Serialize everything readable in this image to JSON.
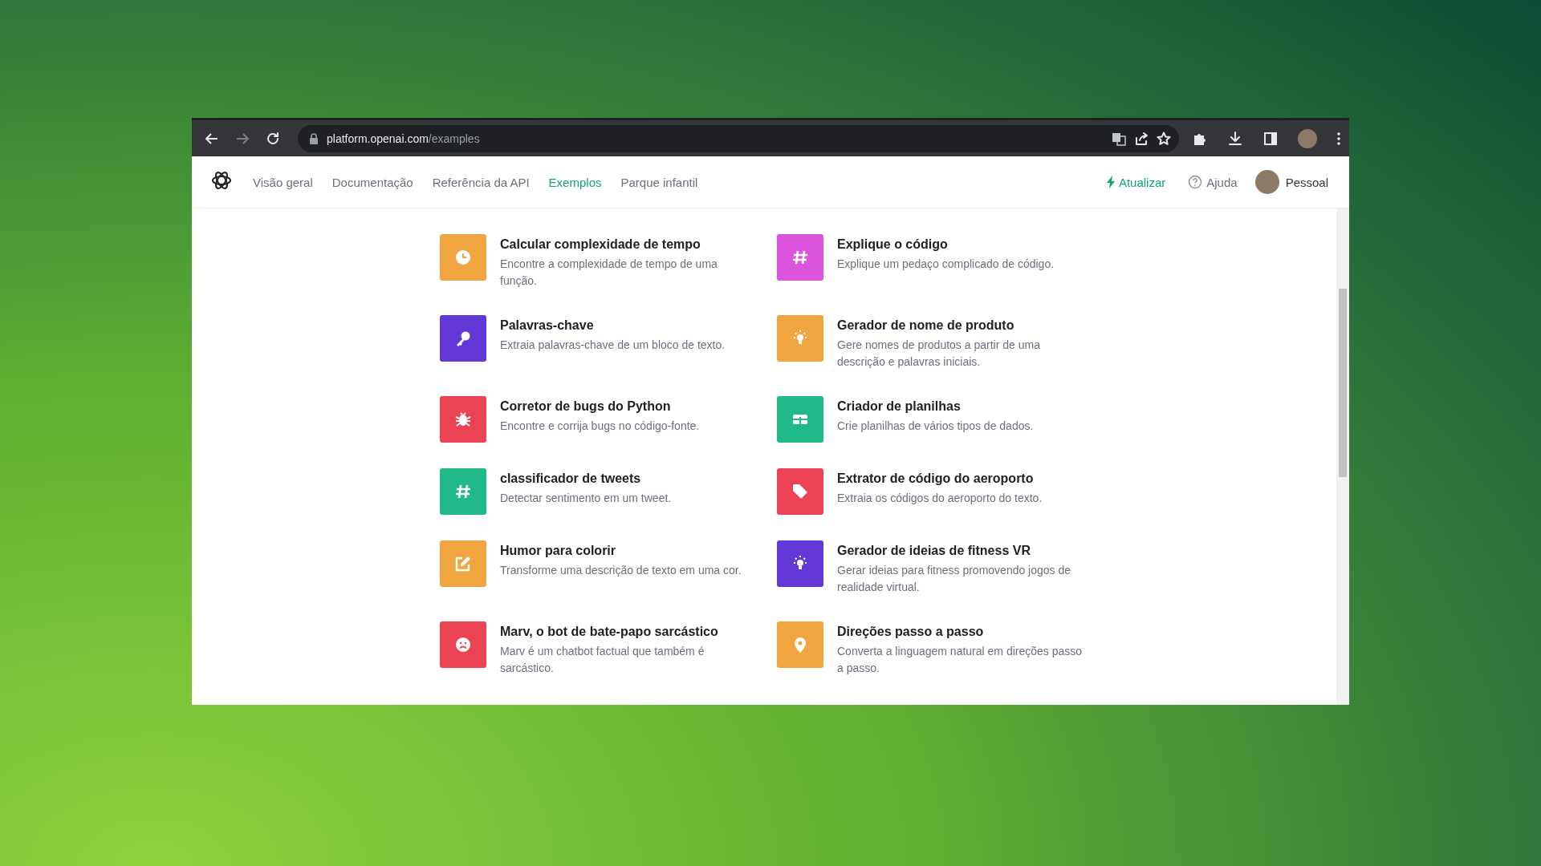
{
  "browser": {
    "url": "platform.openai.com/examples",
    "back_disabled": false,
    "forward_disabled": true
  },
  "nav": {
    "tabs": [
      {
        "label": "Visão geral",
        "selected": false
      },
      {
        "label": "Documentação",
        "selected": false
      },
      {
        "label": "Referência da API",
        "selected": false
      },
      {
        "label": "Exemplos",
        "selected": true
      },
      {
        "label": "Parque infantil",
        "selected": false
      }
    ],
    "upgrade": "Atualizar",
    "help": "Ajuda",
    "account": "Pessoal"
  },
  "examples": [
    {
      "title": "Calcular complexidade de tempo",
      "description": "Encontre a complexidade de tempo de uma função.",
      "color": "#f0a541"
    },
    {
      "title": "Explique o código",
      "description": "Explique um pedaço complicado de código.",
      "color": "#dd55de"
    },
    {
      "title": "Palavras-chave",
      "description": "Extraia palavras-chave de um bloco de texto.",
      "color": "#6238d6"
    },
    {
      "title": "Gerador de nome de produto",
      "description": "Gere nomes de produtos a partir de uma descrição e palavras iniciais.",
      "color": "#f0a541"
    },
    {
      "title": "Corretor de bugs do Python",
      "description": "Encontre e corrija bugs no código-fonte.",
      "color": "#ec4354"
    },
    {
      "title": "Criador de planilhas",
      "description": "Crie planilhas de vários tipos de dados.",
      "color": "#21b98a"
    },
    {
      "title": "classificador de tweets",
      "description": "Detectar sentimento em um tweet.",
      "color": "#21b98a"
    },
    {
      "title": "Extrator de código do aeroporto",
      "description": "Extraia os códigos do aeroporto do texto.",
      "color": "#ec4354"
    },
    {
      "title": "Humor para colorir",
      "description": "Transforme uma descrição de texto em uma cor.",
      "color": "#f0a541"
    },
    {
      "title": "Gerador de ideias de fitness VR",
      "description": "Gerar ideias para fitness promovendo jogos de realidade virtual.",
      "color": "#6238d6"
    },
    {
      "title": "Marv, o bot de bate-papo sarcástico",
      "description": "Marv é um chatbot factual que também é sarcástico.",
      "color": "#ec4354"
    },
    {
      "title": "Direções passo a passo",
      "description": "Converta a linguagem natural em direções passo a passo.",
      "color": "#f0a541"
    }
  ]
}
